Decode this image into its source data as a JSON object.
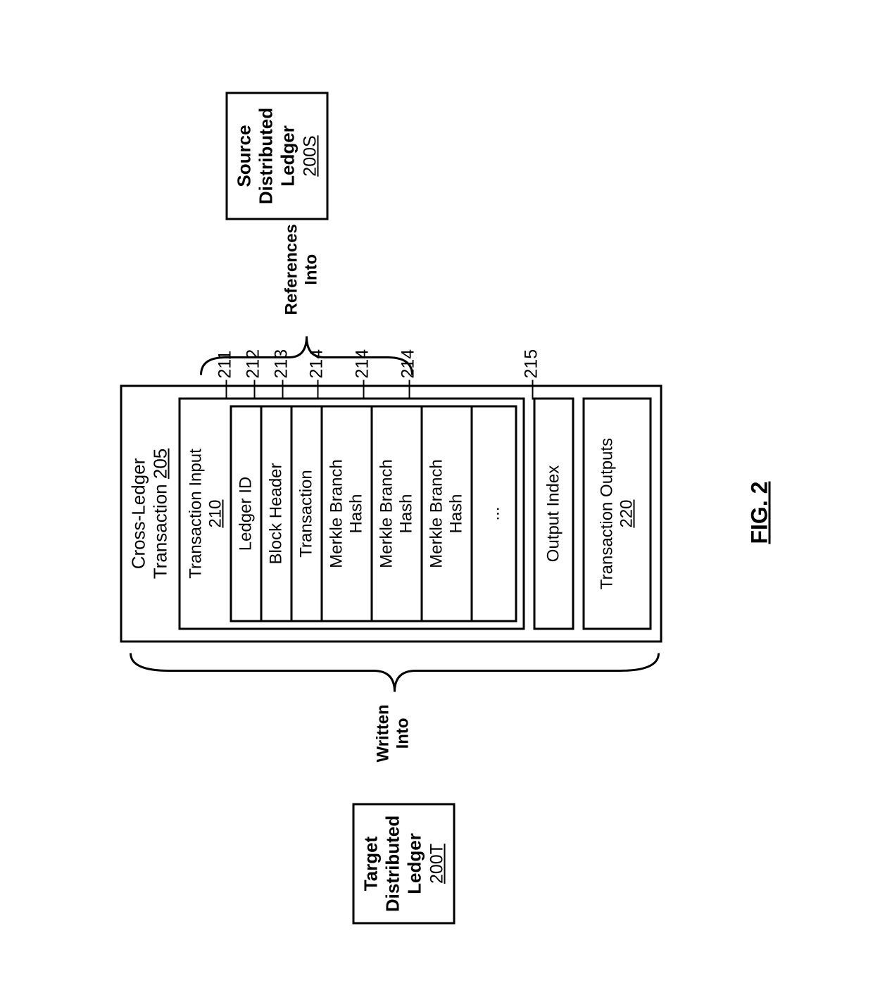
{
  "figure_label": "FIG. 2",
  "target": {
    "line1": "Target",
    "line2": "Distributed",
    "line3": "Ledger",
    "num": "200T"
  },
  "source": {
    "line1": "Source",
    "line2": "Distributed",
    "line3": "Ledger",
    "num": "200S"
  },
  "cross_ledger": {
    "title": "Cross-Ledger",
    "subtitle": "Transaction",
    "num": "205"
  },
  "input": {
    "title": "Transaction Input",
    "num": "210",
    "rows": [
      {
        "label": "Ledger ID",
        "ref": "211"
      },
      {
        "label": "Block Header",
        "ref": "212"
      },
      {
        "label": "Transaction",
        "ref": "213"
      },
      {
        "label": "Merkle Branch Hash",
        "ref": "214"
      },
      {
        "label": "Merkle Branch Hash",
        "ref": "214"
      },
      {
        "label": "Merkle Branch Hash",
        "ref": "214"
      },
      {
        "label": "...",
        "ref": ""
      }
    ]
  },
  "output_index": {
    "label": "Output Index",
    "ref": "215"
  },
  "outputs": {
    "label": "Transaction Outputs",
    "num": "220"
  },
  "brace_left_label": {
    "line1": "Written",
    "line2": "Into"
  },
  "brace_right_label": {
    "line1": "References",
    "line2": "Into"
  }
}
